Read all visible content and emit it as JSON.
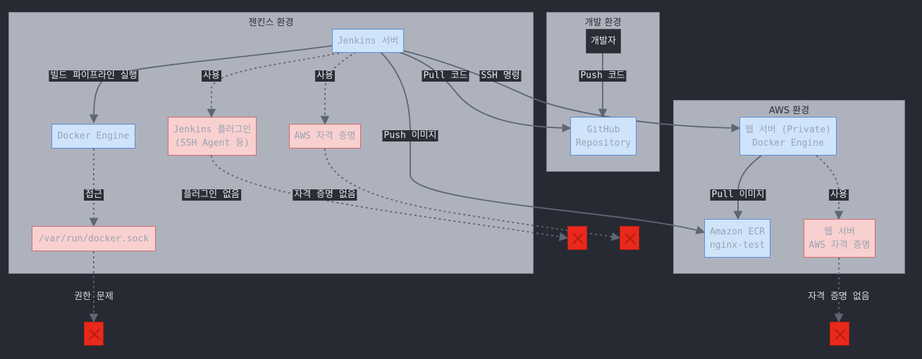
{
  "clusters": {
    "jenkins": {
      "title": "젠킨스 환경"
    },
    "dev": {
      "title": "개발 환경"
    },
    "aws": {
      "title": "AWS 환경"
    }
  },
  "nodes": {
    "jenkins_server": "Jenkins 서버",
    "docker_engine": "Docker Engine",
    "jenkins_plugin": "Jenkins 플러그인\n(SSH Agent 등)",
    "aws_credentials": "AWS 자격 증명",
    "docker_sock": "/var/run/docker.sock",
    "developer": "개발자",
    "github_repo": "GitHub\nRepository",
    "web_server_docker": "웹 서버 (Private)\nDocker Engine",
    "amazon_ecr": "Amazon ECR\nnginx-test",
    "web_server_creds": "웹 서버\nAWS 자격 증명"
  },
  "edges": {
    "run_pipeline": "빌드 파이프라인 실행",
    "use_plugin": "사용",
    "use_creds": "사용",
    "pull_code": "Pull 코드",
    "ssh_command": "SSH 명령",
    "push_image": "Push 이미지",
    "push_code": "Push 코드",
    "access": "접근",
    "no_plugin": "플러그인 없음",
    "no_creds": "자격 증명 없음",
    "pull_image": "Pull 이미지",
    "web_use": "사용",
    "permission_issue": "권한 문제",
    "web_no_creds": "자격 증명 없음"
  },
  "colors": {
    "background": "#272a33",
    "cluster_fill": "#aeb2bd",
    "edge": "#5e6573",
    "node_blue_fill": "#cfe4fb",
    "node_red_fill": "#f9d0d0",
    "error_mark": "#e8291c"
  },
  "icons": [
    "error-x-icon"
  ]
}
